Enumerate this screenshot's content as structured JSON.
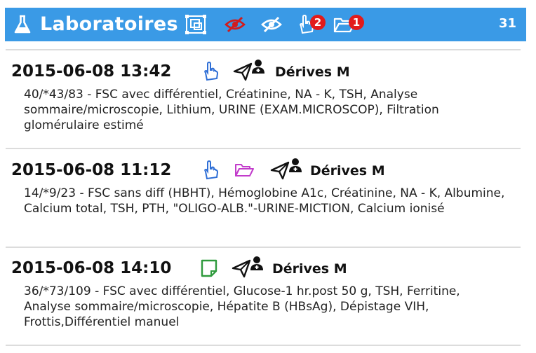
{
  "header": {
    "title": "Laboratoires",
    "count": "31",
    "badge_hand": "2",
    "badge_folder": "1",
    "color": "#3a9ae6"
  },
  "entries": [
    {
      "datetime": "2015-06-08 13:42",
      "icons": [
        "hand-pointer-icon",
        "paper-plane-icon",
        "doctor-icon"
      ],
      "doctor": "Dérives M",
      "description": "40/*43/83 - FSC avec différentiel, Créatinine, NA - K, TSH, Analyse sommaire/microscopie, Lithium, URINE (EXAM.MICROSCOP), Filtration glomérulaire estimé"
    },
    {
      "datetime": "2015-06-08 11:12",
      "icons": [
        "hand-pointer-icon",
        "folder-open-icon",
        "paper-plane-icon",
        "doctor-icon"
      ],
      "doctor": "Dérives M",
      "description": "14/*9/23 - FSC sans diff (HBHT), Hémoglobine A1c, Créatinine, NA - K, Albumine, Calcium total, TSH, PTH, \"OLIGO-ALB.\"-URINE-MICTION, Calcium ionisé"
    },
    {
      "datetime": "2015-06-08 14:10",
      "icons": [
        "sticky-note-icon",
        "paper-plane-icon",
        "doctor-icon"
      ],
      "doctor": "Dérives M",
      "description": "36/*73/109 - FSC avec différentiel, Glucose-1 hr.post 50 g, TSH, Ferritine, Analyse sommaire/microscopie, Hépatite B (HBsAg), Dépistage VIH, Frottis,Différentiel manuel"
    }
  ]
}
